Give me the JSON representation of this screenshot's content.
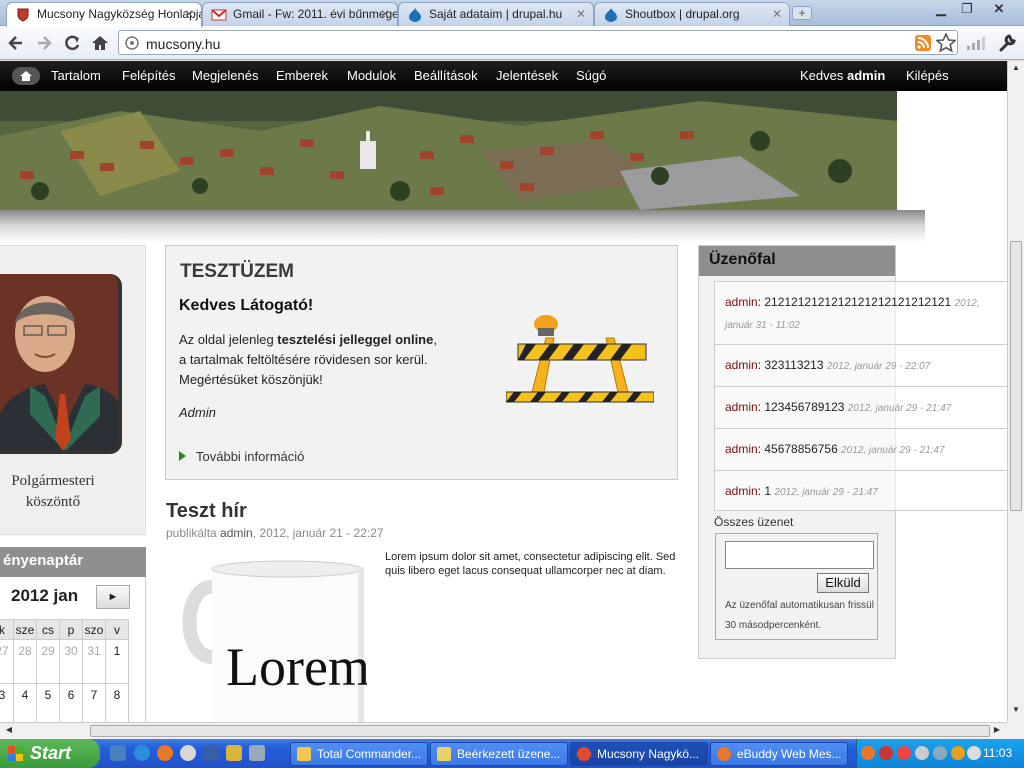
{
  "browser": {
    "tabs": [
      {
        "title": "Mucsony Nagyközség Honlapja",
        "active": true
      },
      {
        "title": "Gmail - Fw: 2011. évi bűnmegelőzési",
        "active": false
      },
      {
        "title": "Saját adataim | drupal.hu",
        "active": false
      },
      {
        "title": "Shoutbox | drupal.org",
        "active": false
      }
    ],
    "url": "mucsony.hu",
    "new_tab_label": "+"
  },
  "admin_menu": {
    "items": [
      "Tartalom",
      "Felépítés",
      "Megjelenés",
      "Emberek",
      "Modulok",
      "Beállítások",
      "Jelentések",
      "Súgó"
    ],
    "greeting_prefix": "Kedves",
    "greeting_user": "admin",
    "logout": "Kilépés"
  },
  "left": {
    "mayor_title_1": "Polgármesteri",
    "mayor_title_2": "köszöntő"
  },
  "calendar": {
    "heading": "ényenaptár",
    "month": "2012 jan",
    "next_label": "►",
    "day_headers": [
      "k",
      "sze",
      "cs",
      "p",
      "szo",
      "v"
    ],
    "row1": [
      "27",
      "28",
      "29",
      "30",
      "31",
      "1"
    ],
    "row2": [
      "3",
      "4",
      "5",
      "6",
      "7",
      "8"
    ]
  },
  "notice": {
    "heading": "TESZTÜZEM",
    "greeting": "Kedves Látogató!",
    "line1_a": "Az oldal jelenleg ",
    "line1_b": "tesztelési jelleggel online",
    "line1_c": ",",
    "line2": "a tartalmak feltöltésére rövidesen sor kerül.",
    "line3": "Megértésüket köszönjük!",
    "signature": "Admin",
    "more_link": "További információ"
  },
  "news": {
    "title": "Teszt hír",
    "meta_prefix": "publikálta",
    "meta_author": "admin",
    "meta_date": ", 2012, január 21 - 22:27",
    "body": "Lorem ipsum dolor sit amet, consectetur adipiscing elit. Sed quis libero eget lacus consequat ullamcorper nec at diam.",
    "mug_text": "Lorem"
  },
  "shoutbox": {
    "heading": "Üzenőfal",
    "messages": [
      {
        "user": "admin",
        "text": "2121212121212121212121212121",
        "date": "2012, január 31 - 11:02"
      },
      {
        "user": "admin",
        "text": "323113213",
        "date": "2012, január 29 - 22:07"
      },
      {
        "user": "admin",
        "text": "123456789123",
        "date": "2012, január 29 - 21:47"
      },
      {
        "user": "admin",
        "text": "45678856756",
        "date": "2012, január 29 - 21:47"
      },
      {
        "user": "admin",
        "text": "1",
        "date": "2012, január 29 - 21:47"
      }
    ],
    "all_messages": "Összes üzenet",
    "send_button": "Elküld",
    "note": "Az üzenőfal automatikusan frissül 30 másodpercenként."
  },
  "taskbar": {
    "start": "Start",
    "tasks": [
      "Total Commander...",
      "Beérkezett üzene...",
      "Mucsony Nagykö...",
      "eBuddy Web Mes..."
    ],
    "clock": "11:03"
  }
}
